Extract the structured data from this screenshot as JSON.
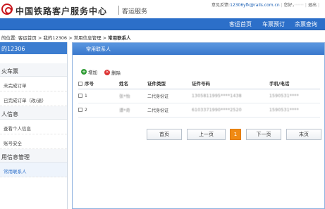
{
  "header": {
    "site_title": "中国铁路客户服务中心",
    "service_title": "客运服务",
    "feedback_label": "意见反馈:",
    "feedback_email": "12306yfk@rails.com.cn",
    "greeting": "您好，",
    "exit_label": "退出"
  },
  "nav": {
    "items": [
      "客运首页",
      "车票预订",
      "余票查询"
    ]
  },
  "breadcrumb": {
    "prefix": "的位置: 客运首页 > 我的12306 > 常用信息管理 > ",
    "current": "常用联系人"
  },
  "sidebar": {
    "header": "的12306",
    "groups": [
      {
        "label": "火车票",
        "items": [
          "未完成订单",
          "已完成订单（改/退）"
        ]
      },
      {
        "label": "人信息",
        "items": [
          "查看个人信息",
          "账号安全"
        ]
      },
      {
        "label": "用信息管理",
        "items": [
          "常用联系人"
        ]
      }
    ]
  },
  "panel": {
    "title": "常用联系人",
    "add_label": "增加",
    "delete_label": "删除",
    "columns": [
      "序号",
      "姓名",
      "证件类型",
      "证件号码",
      "手机/电话"
    ],
    "rows": [
      {
        "index": "1",
        "name": "张*怡",
        "id_type": "二代身份证",
        "id_no": "1305811995****1438",
        "phone": "1590531****"
      },
      {
        "index": "2",
        "name": "谭*奇",
        "id_type": "二代身份证",
        "id_no": "6103371990****2520",
        "phone": "1590531****"
      }
    ],
    "pager": {
      "first": "首页",
      "prev": "上一页",
      "current": "1",
      "next": "下一页",
      "last": "末页"
    }
  },
  "colors": {
    "nav_blue": "#2c6fc9",
    "brand_red": "#c8161d",
    "pager_current": "#f08a14"
  }
}
